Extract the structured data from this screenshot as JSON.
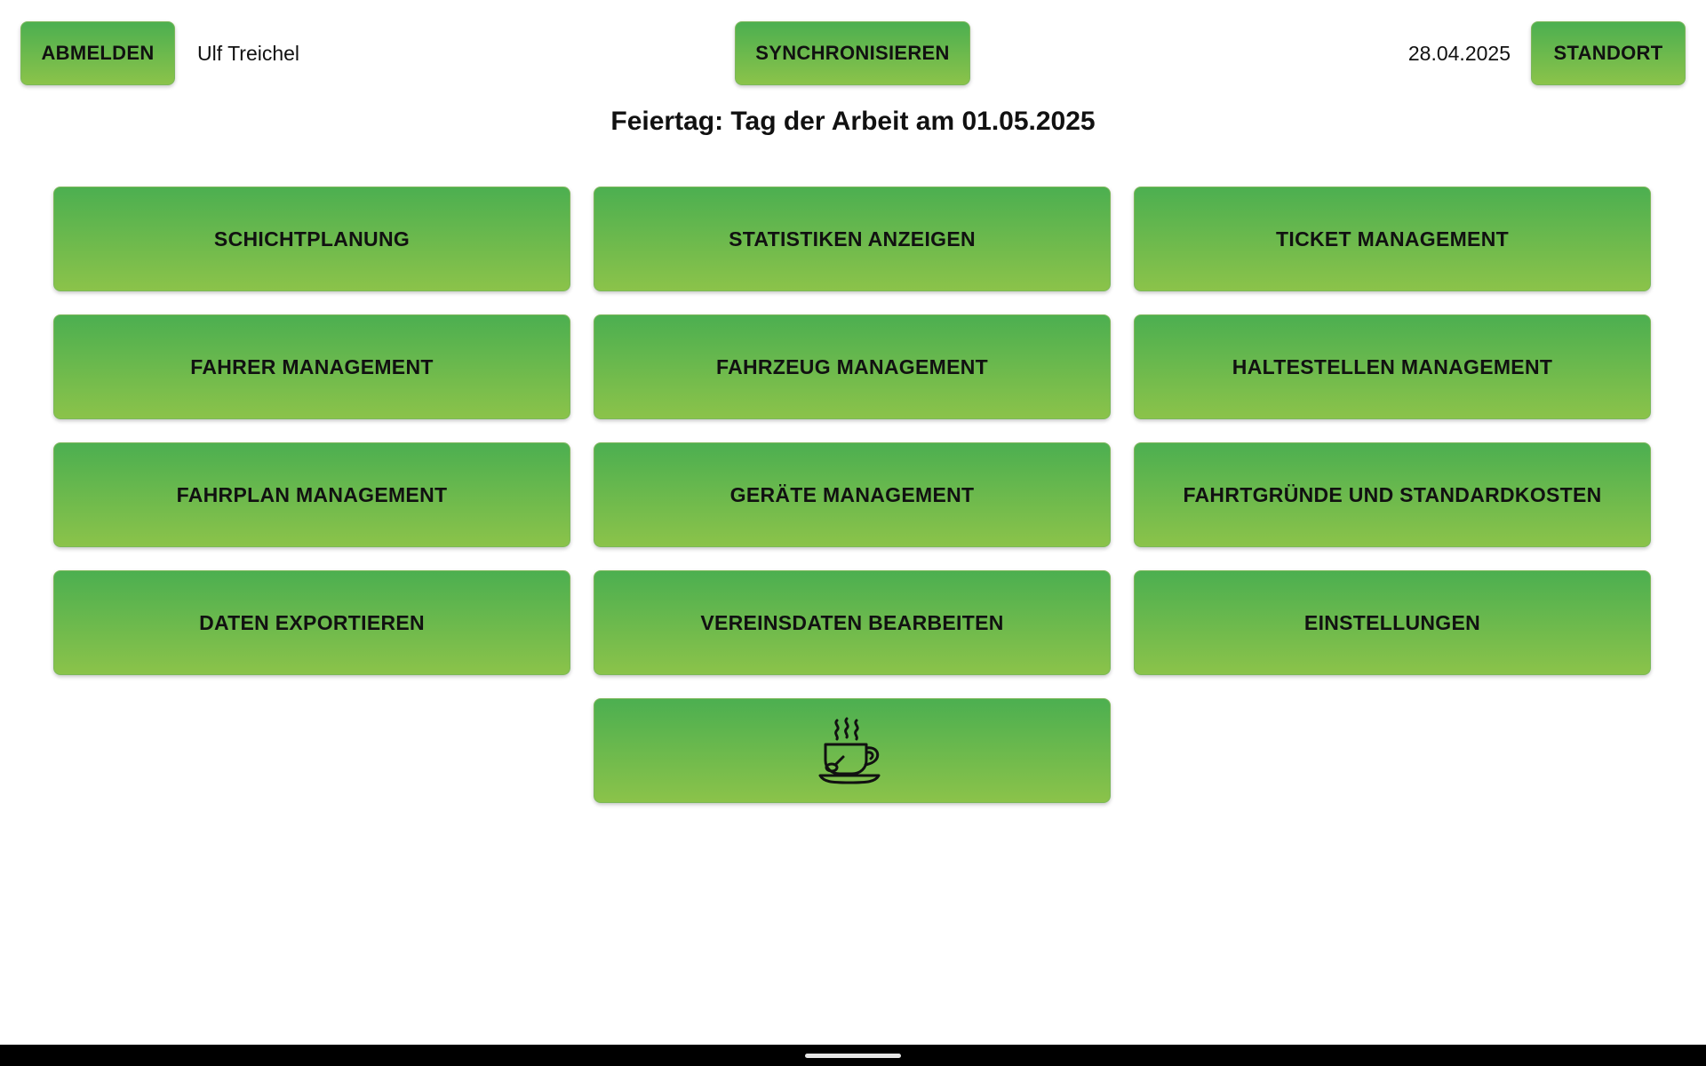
{
  "header": {
    "logout_label": "ABMELDEN",
    "user_name": "Ulf Treichel",
    "sync_label": "SYNCHRONISIEREN",
    "date": "28.04.2025",
    "location_label": "STANDORT"
  },
  "holiday_notice": "Feiertag: Tag der Arbeit am 01.05.2025",
  "menu": {
    "schichtplanung": "SCHICHTPLANUNG",
    "statistiken": "STATISTIKEN ANZEIGEN",
    "ticket": "TICKET MANAGEMENT",
    "fahrer": "FAHRER MANAGEMENT",
    "fahrzeug": "FAHRZEUG MANAGEMENT",
    "haltestellen": "HALTESTELLEN MANAGEMENT",
    "fahrplan": "FAHRPLAN MANAGEMENT",
    "geraete": "GERÄTE MANAGEMENT",
    "fahrtgruende": "FAHRTGRÜNDE UND STANDARDKOSTEN",
    "export": "DATEN EXPORTIEREN",
    "vereinsdaten": "VEREINSDATEN BEARBEITEN",
    "einstellungen": "EINSTELLUNGEN",
    "break_icon": "coffee-cup-icon"
  },
  "colors": {
    "button_gradient_top": "#4caf50",
    "button_gradient_bottom": "#8bc34a",
    "background": "#ffffff",
    "nav_bar": "#000000"
  }
}
